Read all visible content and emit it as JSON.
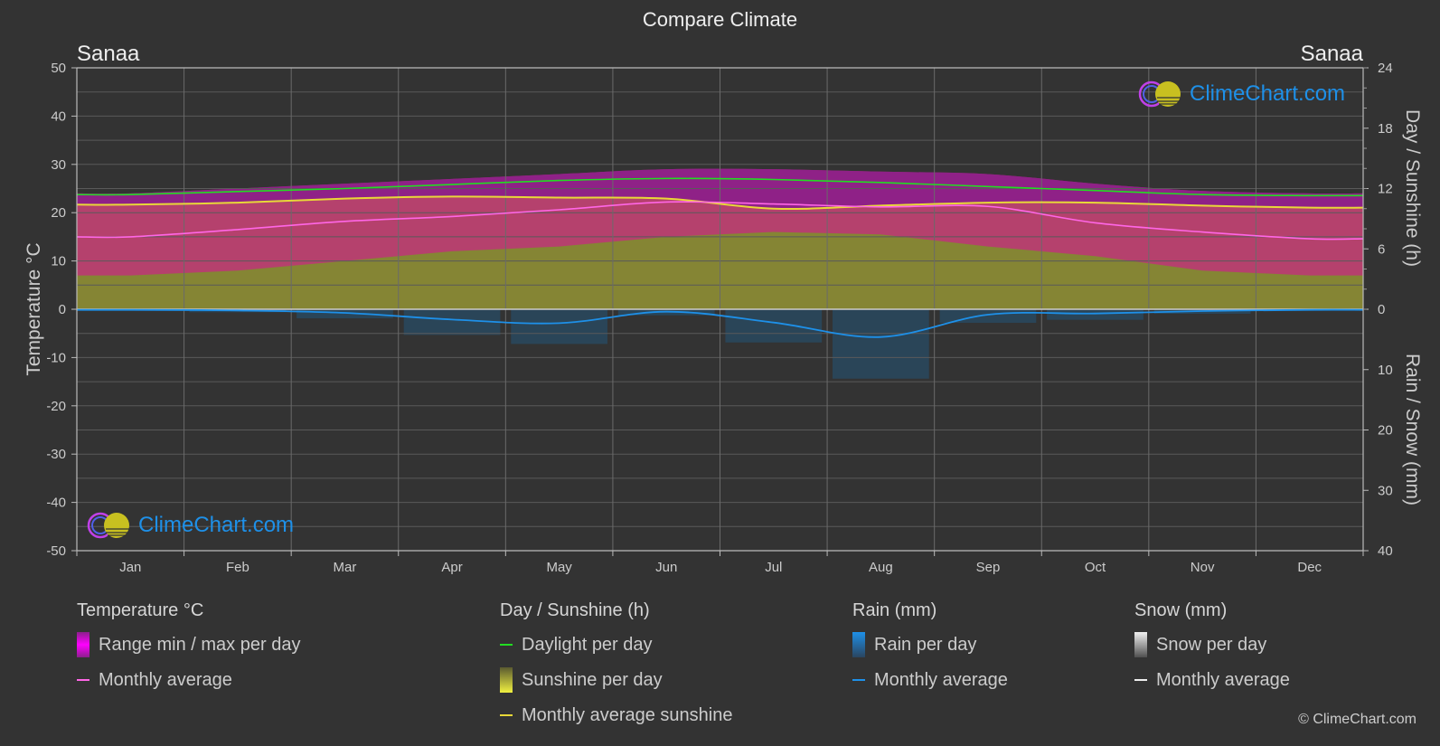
{
  "title": "Compare Climate",
  "city_left": "Sanaa",
  "city_right": "Sanaa",
  "logo_text": "ClimeChart.com",
  "copyright": "© ClimeChart.com",
  "colors": {
    "background": "#333333",
    "temp_range": "#c0307c",
    "temp_range_top": "#8c1f8c",
    "temp_avg": "#ff66e6",
    "daylight": "#22dd22",
    "sunshine_fill": "#8a8a35",
    "sunshine_avg": "#e8d838",
    "rain_fill": "#1f5a85",
    "rain_avg": "#1e90e8",
    "grid": "#5a5a5a",
    "logo": "#1e90e8"
  },
  "legend": {
    "temperature": {
      "header": "Temperature °C",
      "range": "Range min / max per day",
      "avg": "Monthly average"
    },
    "sunshine": {
      "header": "Day / Sunshine (h)",
      "daylight": "Daylight per day",
      "sunshine": "Sunshine per day",
      "avg": "Monthly average sunshine"
    },
    "rain": {
      "header": "Rain (mm)",
      "per_day": "Rain per day",
      "avg": "Monthly average"
    },
    "snow": {
      "header": "Snow (mm)",
      "per_day": "Snow per day",
      "avg": "Monthly average"
    }
  },
  "chart_data": {
    "type": "line",
    "title": "Compare Climate",
    "categories": [
      "Jan",
      "Feb",
      "Mar",
      "Apr",
      "May",
      "Jun",
      "Jul",
      "Aug",
      "Sep",
      "Oct",
      "Nov",
      "Dec"
    ],
    "ylabel_left": "Temperature °C",
    "ylabel_right_top": "Day / Sunshine (h)",
    "ylabel_right_bottom": "Rain / Snow (mm)",
    "ylim_left": [
      -50,
      50
    ],
    "yticks_left": [
      50,
      40,
      30,
      20,
      10,
      0,
      -10,
      -20,
      -30,
      -40,
      -50
    ],
    "ylim_sunshine": [
      0,
      24
    ],
    "yticks_sunshine": [
      24,
      18,
      12,
      6,
      0
    ],
    "ylim_rain": [
      0,
      40
    ],
    "yticks_rain": [
      0,
      10,
      20,
      30,
      40
    ],
    "grid": true,
    "legend_position": "bottom",
    "series": [
      {
        "name": "Temperature monthly average",
        "axis": "temperature",
        "values": [
          15.0,
          16.5,
          18.2,
          19.2,
          20.6,
          22.2,
          21.8,
          21.2,
          21.3,
          17.9,
          16.0,
          14.6
        ]
      },
      {
        "name": "Temperature max per day (typical)",
        "axis": "temperature",
        "values": [
          24,
          25,
          26,
          27,
          28,
          29,
          29,
          28.5,
          28,
          26,
          24.5,
          24
        ]
      },
      {
        "name": "Temperature min per day (typical)",
        "axis": "temperature",
        "values": [
          7,
          8,
          10,
          12,
          13,
          15,
          16,
          15.5,
          13,
          11,
          8,
          7
        ]
      },
      {
        "name": "Daylight per day",
        "axis": "sunshine",
        "values": [
          11.4,
          11.7,
          12.0,
          12.4,
          12.8,
          13.0,
          12.9,
          12.6,
          12.2,
          11.8,
          11.4,
          11.3
        ]
      },
      {
        "name": "Monthly average sunshine",
        "axis": "sunshine",
        "values": [
          10.4,
          10.6,
          11.0,
          11.2,
          11.1,
          11.0,
          10.0,
          10.3,
          10.6,
          10.6,
          10.3,
          10.1
        ]
      },
      {
        "name": "Rain monthly average",
        "axis": "rain",
        "values": [
          0.1,
          0.2,
          0.6,
          1.7,
          2.3,
          0.4,
          2.2,
          4.6,
          0.9,
          0.7,
          0.3,
          0.1
        ]
      },
      {
        "name": "Snow monthly average",
        "axis": "rain",
        "values": [
          0,
          0,
          0,
          0,
          0,
          0,
          0,
          0,
          0,
          0,
          0,
          0
        ]
      }
    ]
  }
}
